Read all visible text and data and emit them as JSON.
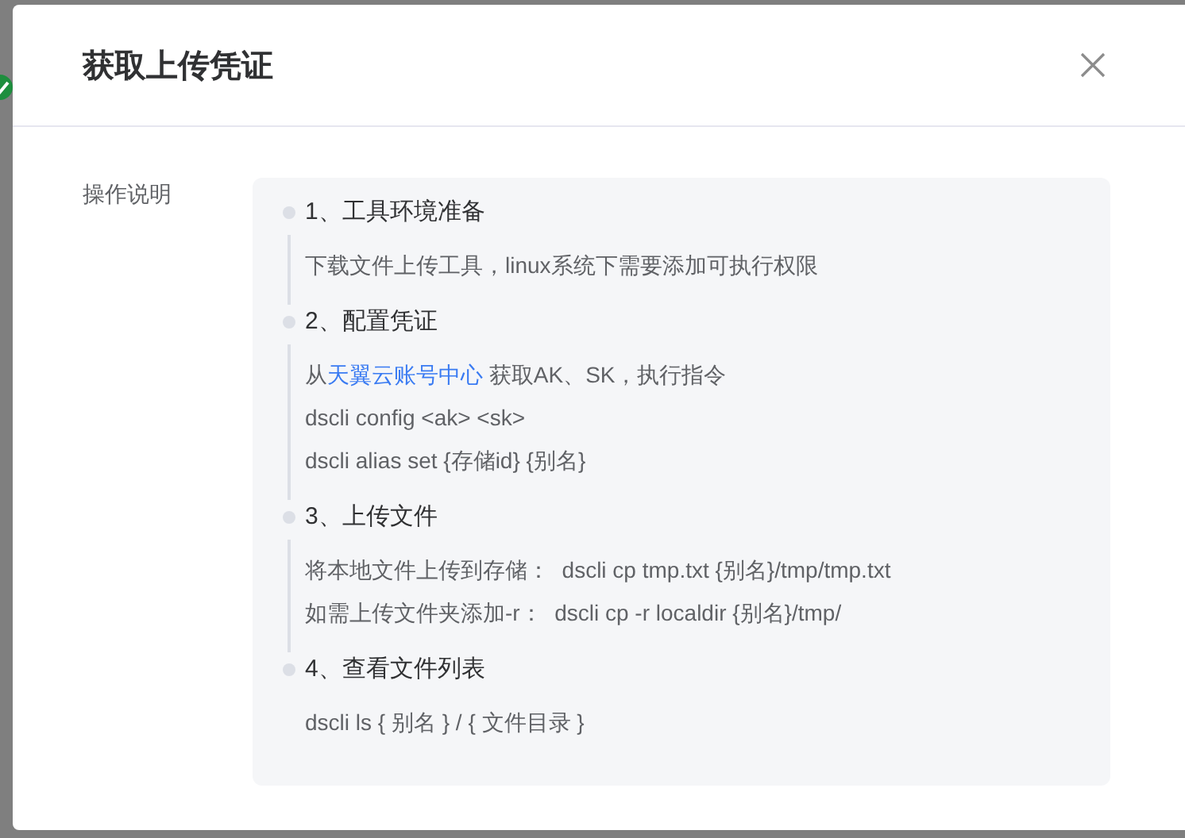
{
  "dialog": {
    "title": "获取上传凭证",
    "section_label": "操作说明",
    "steps": [
      {
        "title": "1、工具环境准备",
        "lines": [
          [
            {
              "kind": "text",
              "text": "下载文件上传工具，linux系统下需要添加可执行权限"
            }
          ]
        ]
      },
      {
        "title": "2、配置凭证",
        "lines": [
          [
            {
              "kind": "text",
              "text": "从"
            },
            {
              "kind": "link",
              "text": "天翼云账号中心"
            },
            {
              "kind": "text",
              "text": " 获取AK、SK，执行指令"
            }
          ],
          [
            {
              "kind": "text",
              "text": "dscli config <ak> <sk>"
            }
          ],
          [
            {
              "kind": "text",
              "text": "dscli alias set {存储id} {别名}"
            }
          ]
        ]
      },
      {
        "title": "3、上传文件",
        "lines": [
          [
            {
              "kind": "text",
              "text": "将本地文件上传到存储：  dscli cp tmp.txt {别名}/tmp/tmp.txt"
            }
          ],
          [
            {
              "kind": "text",
              "text": "如需上传文件夹添加-r：  dscli cp -r localdir {别名}/tmp/"
            }
          ]
        ]
      },
      {
        "title": "4、查看文件列表",
        "lines": [
          [
            {
              "kind": "text",
              "text": "dscli ls { 别名 } / { 文件目录 }"
            }
          ]
        ]
      }
    ]
  }
}
